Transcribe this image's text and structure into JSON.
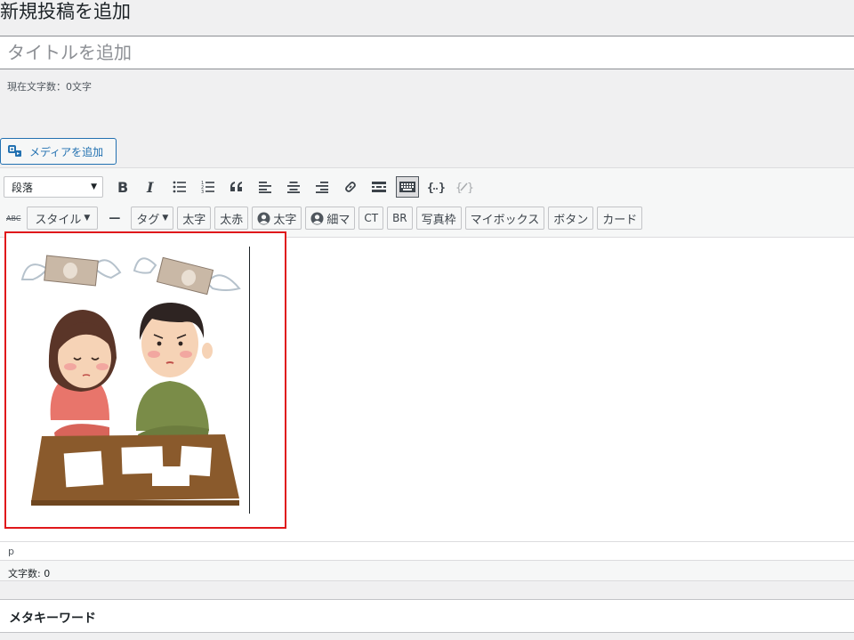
{
  "page": {
    "heading": "新規投稿を追加"
  },
  "title_field": {
    "placeholder": "タイトルを追加"
  },
  "char_count": "現在文字数：0文字",
  "media_button": {
    "label": "メディアを追加",
    "icon": "media-icon"
  },
  "toolbar": {
    "format_select": "段落",
    "row1_icons": [
      "bold-icon",
      "italic-icon",
      "bullet-list-icon",
      "numbered-list-icon",
      "blockquote-icon",
      "align-left-icon",
      "align-center-icon",
      "align-right-icon",
      "link-icon",
      "read-more-icon",
      "toolbar-toggle-icon",
      "code-block-icon",
      "code-inactive-icon"
    ],
    "row2": {
      "strikethrough": "ABC",
      "style_label": "スタイル",
      "hr_label": "—",
      "tag_label": "タグ",
      "buttons": [
        "太字",
        "太赤",
        "太字",
        "細マ",
        "CT",
        "BR",
        "写真枠",
        "マイボックス",
        "ボタン",
        "カード"
      ]
    }
  },
  "status_path": "p",
  "word_count": "文字数: 0",
  "meta_box": {
    "title": "メタキーワード"
  },
  "colors": {
    "selection_border": "#e0181b",
    "accent_blue": "#2271b1",
    "background": "#f0f0f1"
  }
}
